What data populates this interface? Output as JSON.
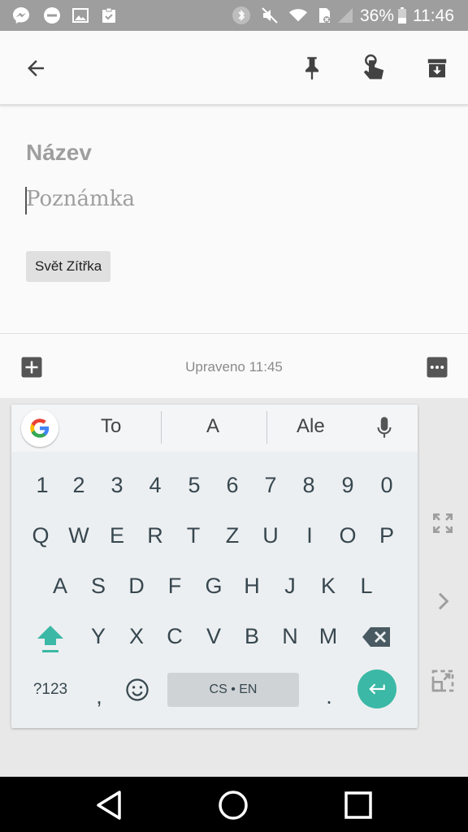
{
  "status_bar": {
    "battery_percent": "36%",
    "time": "11:46",
    "left_icons": [
      "messenger-icon",
      "do-not-disturb-icon",
      "image-icon",
      "clipboard-check-icon"
    ],
    "right_icons": [
      "bluetooth-icon",
      "mute-icon",
      "wifi-icon",
      "no-sim-icon",
      "signal-icon",
      "battery-icon"
    ]
  },
  "toolbar": {
    "back_icon": "arrow-back-icon",
    "pin_icon": "pin-icon",
    "reminder_icon": "hand-reminder-icon",
    "archive_icon": "archive-icon"
  },
  "editor": {
    "title_placeholder": "Název",
    "note_placeholder": "Poznámka",
    "label": "Svět Zítřka"
  },
  "bottom_bar": {
    "edited_text": "Upraveno 11:45",
    "add_icon": "add-box-icon",
    "more_icon": "more-horizontal-icon"
  },
  "keyboard": {
    "suggestions": [
      "To",
      "A",
      "Ale"
    ],
    "row_numbers": [
      "1",
      "2",
      "3",
      "4",
      "5",
      "6",
      "7",
      "8",
      "9",
      "0"
    ],
    "row1": [
      "Q",
      "W",
      "E",
      "R",
      "T",
      "Z",
      "U",
      "I",
      "O",
      "P"
    ],
    "row2": [
      "A",
      "S",
      "D",
      "F",
      "G",
      "H",
      "J",
      "K",
      "L"
    ],
    "row3": [
      "Y",
      "X",
      "C",
      "V",
      "B",
      "N",
      "M"
    ],
    "symbols_key": "?123",
    "comma_key": ",",
    "period_key": ".",
    "space_label": "CS • EN",
    "accent_color": "#3bb8a6"
  },
  "nav_bar": {
    "back_icon": "nav-back-icon",
    "home_icon": "nav-home-icon",
    "recents_icon": "nav-recents-icon"
  }
}
